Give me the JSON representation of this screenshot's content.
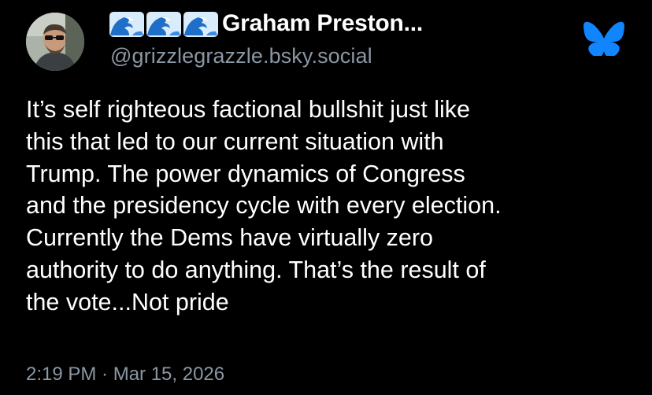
{
  "author": {
    "display_name": "Graham Preston...",
    "name_emoji": [
      "ocean-wave-icon",
      "ocean-wave-icon",
      "ocean-wave-icon"
    ],
    "handle": "@grizzlegrazzle.bsky.social",
    "avatar": "avatar-man-with-sunglasses"
  },
  "platform_icon": "bluesky-butterfly-icon",
  "post": {
    "text": "It’s self righteous factional bullshit just like\nthis that led to our current situation with\nTrump.  The power dynamics of Congress\nand the presidency cycle with every election.\nCurrently the Dems have virtually zero\nauthority to do anything.  That’s the result of\nthe vote...Not pride",
    "timestamp": "2:19 PM · Mar 15, 2026"
  },
  "colors": {
    "background": "#000000",
    "text": "#ffffff",
    "secondary_text": "#8b97a3",
    "bluesky_blue": "#1185fe"
  }
}
